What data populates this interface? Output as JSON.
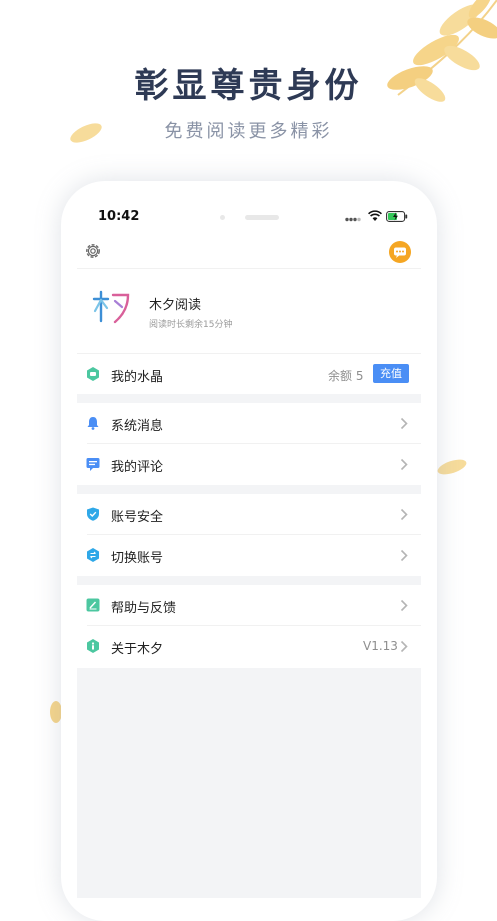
{
  "promo": {
    "headline": "彰显尊贵身份",
    "subline": "免费阅读更多精彩"
  },
  "status_bar": {
    "time": "10:42"
  },
  "top_bar": {
    "settings_icon": "gear-icon",
    "message_icon": "chat-bubble-icon",
    "accent": "#f5a623"
  },
  "profile": {
    "name": "木夕阅读",
    "remaining": "阅读时长剩余15分钟"
  },
  "crystals": {
    "label": "我的水晶",
    "balance": "余额 5",
    "recharge_label": "充值"
  },
  "menu": {
    "system_messages": "系统消息",
    "my_comments": "我的评论",
    "account_security": "账号安全",
    "switch_account": "切换账号",
    "help_feedback": "帮助与反馈",
    "about": "关于木夕",
    "version": "V1.13"
  },
  "colors": {
    "primary_blue": "#4a8ef5",
    "green": "#4cc7a0",
    "title": "#2e3a55",
    "leaf": "#f6d58a"
  }
}
